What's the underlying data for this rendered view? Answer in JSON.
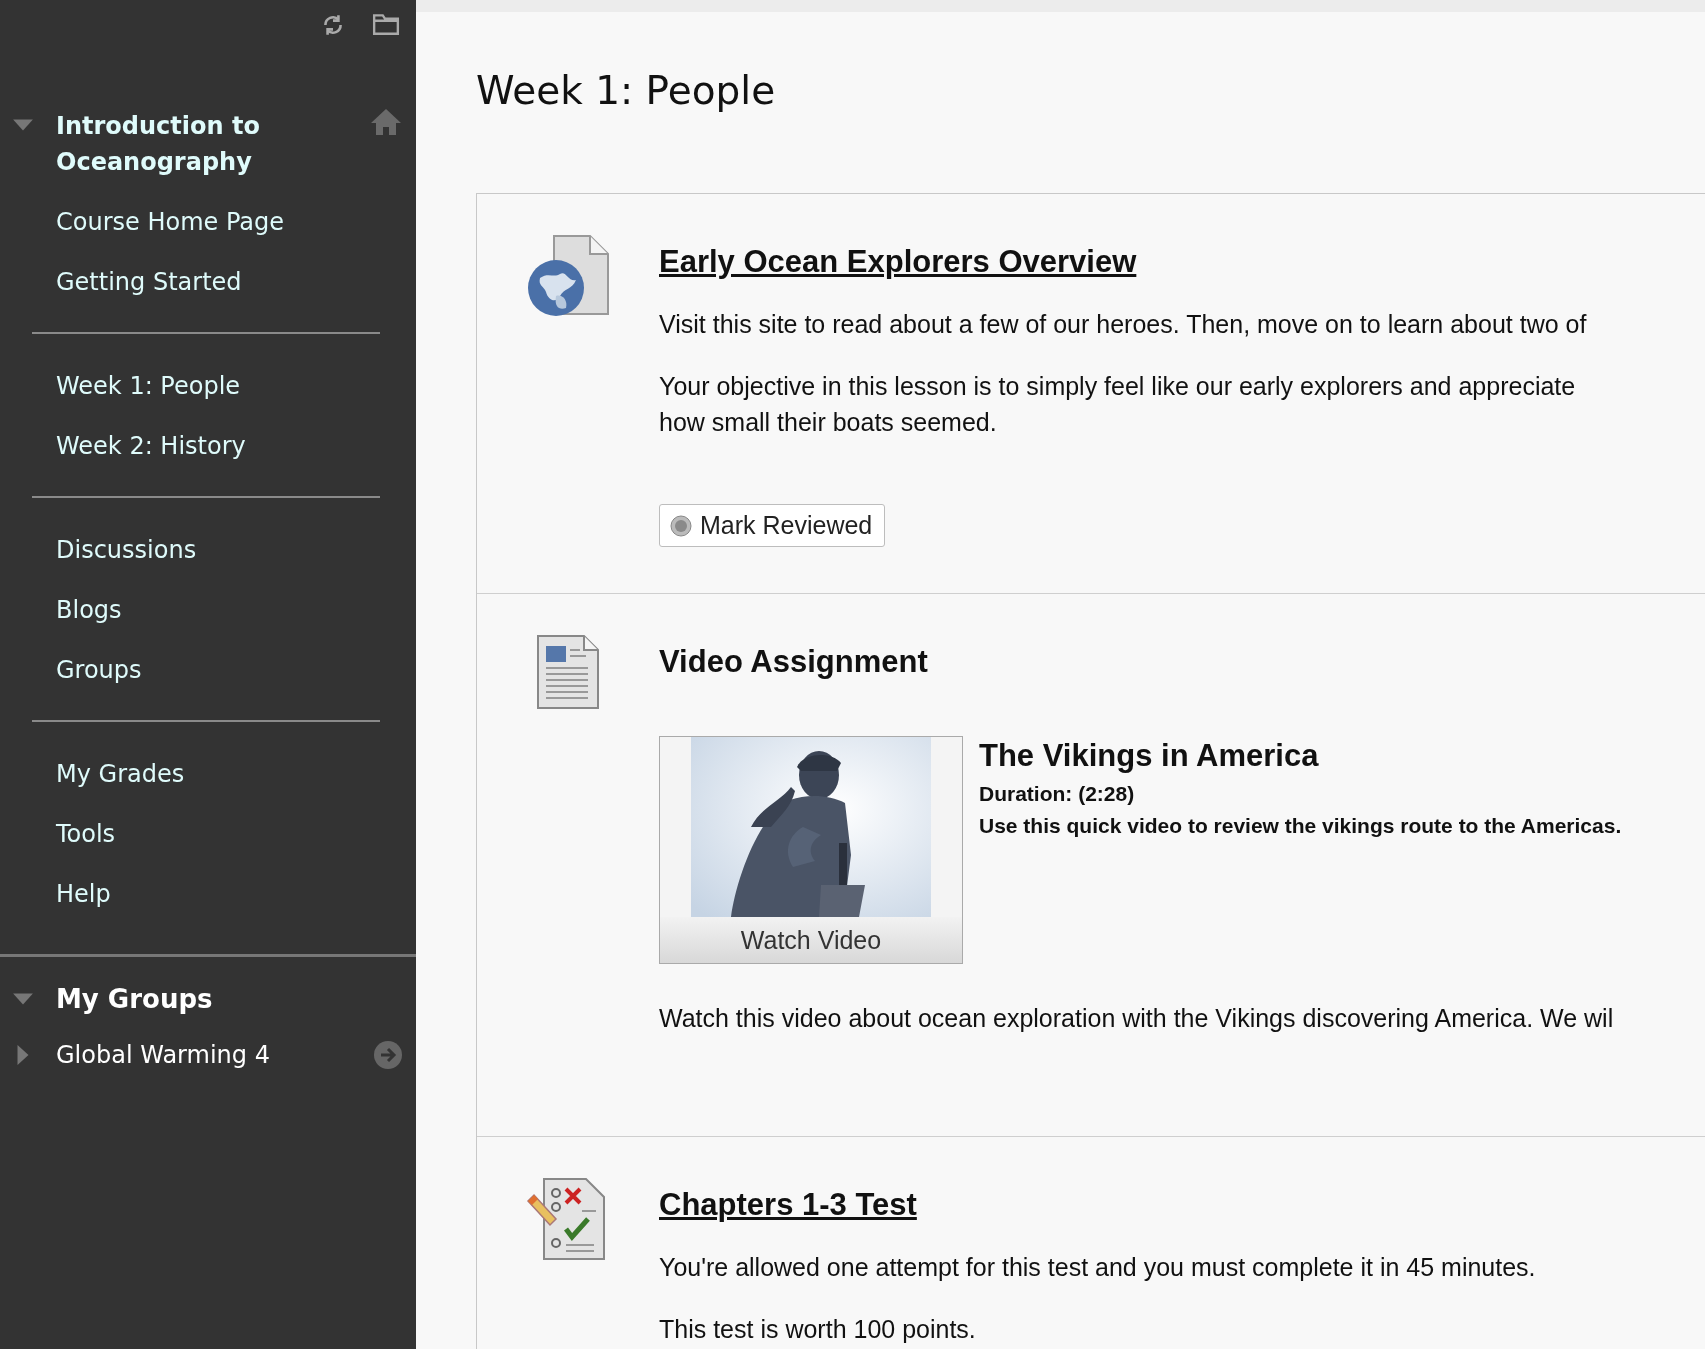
{
  "sidebar": {
    "course": {
      "title": "Introduction to Oceanography",
      "expanded": true
    },
    "menu_groups": [
      {
        "items": [
          {
            "label": "Course Home Page"
          },
          {
            "label": "Getting Started"
          }
        ]
      },
      {
        "items": [
          {
            "label": "Week 1: People"
          },
          {
            "label": "Week 2: History"
          }
        ]
      },
      {
        "items": [
          {
            "label": "Discussions"
          },
          {
            "label": "Blogs"
          },
          {
            "label": "Groups"
          }
        ]
      },
      {
        "items": [
          {
            "label": "My Grades"
          },
          {
            "label": "Tools"
          },
          {
            "label": "Help"
          }
        ]
      }
    ],
    "my_groups": {
      "title": "My Groups",
      "expanded": true,
      "items": [
        {
          "label": "Global Warming 4",
          "expanded": false
        }
      ]
    }
  },
  "page": {
    "title": "Week 1: People"
  },
  "items": [
    {
      "kind": "link",
      "title": "Early Ocean Explorers Overview",
      "paragraphs": [
        [
          "Visit this site to read about a few of our heroes. Then, move on to learn about two of"
        ],
        [
          "Your objective in this lesson is to simply feel like our early explorers and appreciate",
          "how small their boats seemed."
        ]
      ],
      "button": "Mark Reviewed"
    },
    {
      "kind": "video",
      "title": "Video Assignment",
      "video": {
        "button": "Watch Video",
        "title": "The Vikings in America",
        "duration": "Duration: (2:28)",
        "description": "Use this quick video to review the vikings route to the Americas."
      },
      "paragraphs": [
        [
          "Watch this video about ocean exploration with the Vikings discovering America. We wil"
        ]
      ]
    },
    {
      "kind": "test",
      "title": "Chapters 1-3 Test",
      "paragraphs": [
        [
          "You're allowed one attempt for this test and you must complete it in 45 minutes."
        ],
        [
          "This test is worth 100 points."
        ]
      ]
    }
  ]
}
